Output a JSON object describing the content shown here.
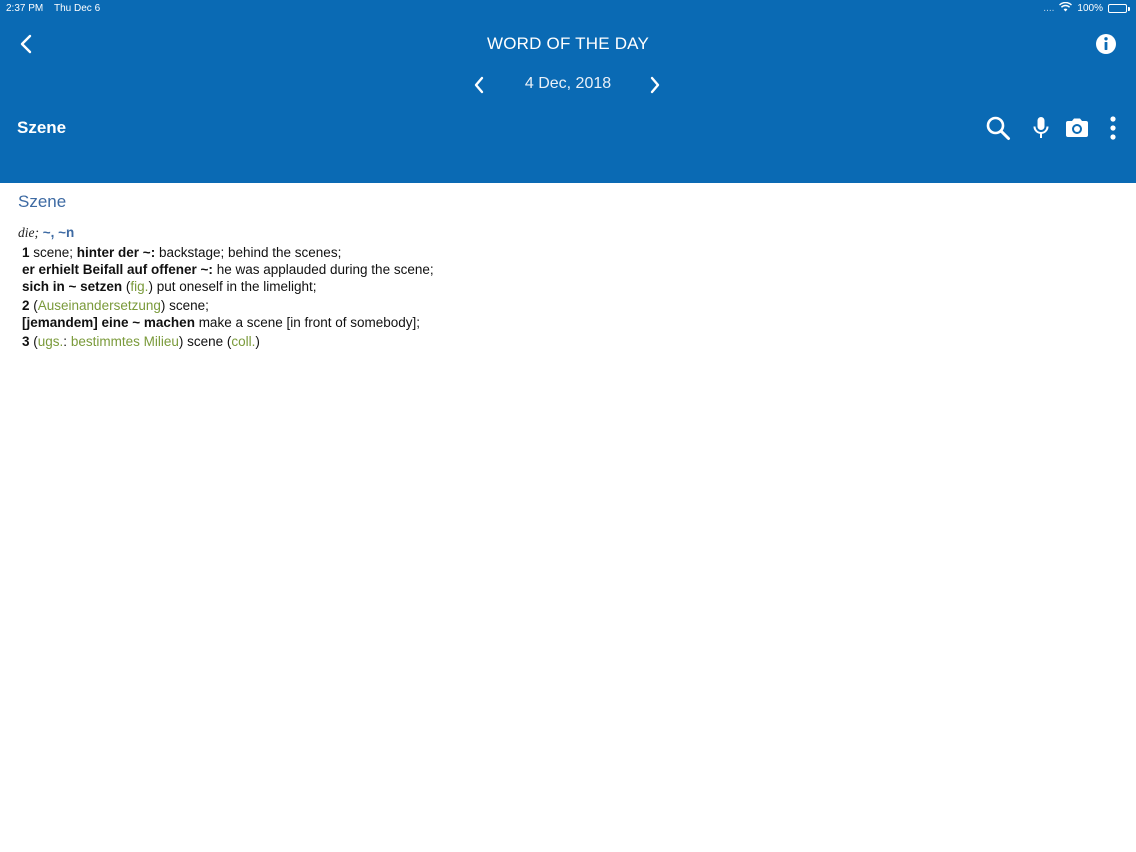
{
  "status": {
    "time": "2:37 PM",
    "date": "Thu Dec 6",
    "signal_dots": "....",
    "battery_percent": "100%",
    "battery_level": 1.0
  },
  "header": {
    "title": "WORD OF THE DAY",
    "date": "4 Dec, 2018",
    "search_word": "Szene"
  },
  "icons": {
    "back": "chevron-left-icon",
    "info": "info-icon",
    "prev": "chevron-left-icon",
    "next": "chevron-right-icon",
    "search": "search-icon",
    "mic": "microphone-icon",
    "camera": "camera-icon",
    "more": "more-vertical-icon"
  },
  "colors": {
    "header_bg": "#0a6ab4",
    "headword": "#3d6aa3",
    "label_green": "#7a9a3a"
  },
  "entry": {
    "headword": "Szene",
    "gram": "die;",
    "inflection": "~, ~n",
    "sense1": {
      "num": "1",
      "t1": " scene; ",
      "b1": "hinter der ~:",
      "t2": " backstage; behind the scenes;",
      "b2": "er erhielt Beifall auf offener ~:",
      "t3": " he was applauded during the scene;",
      "b3": "sich in ~ setzen",
      "p1": " (",
      "g1": "fig.",
      "p2": ")",
      "t4": " put oneself in the limelight;"
    },
    "sense2": {
      "num": "2",
      "p1": " (",
      "g1": "Auseinandersetzung",
      "p2": ")",
      "t1": " scene;",
      "b1": "[jemandem] eine ~ machen",
      "t2": " make a scene [in front of somebody];"
    },
    "sense3": {
      "num": "3",
      "p1": " (",
      "g1": "ugs.",
      "p2": ": ",
      "g2": "bestimmtes Milieu",
      "p3": ")",
      "t1": " scene (",
      "g3": "coll.",
      "p4": ")"
    }
  }
}
